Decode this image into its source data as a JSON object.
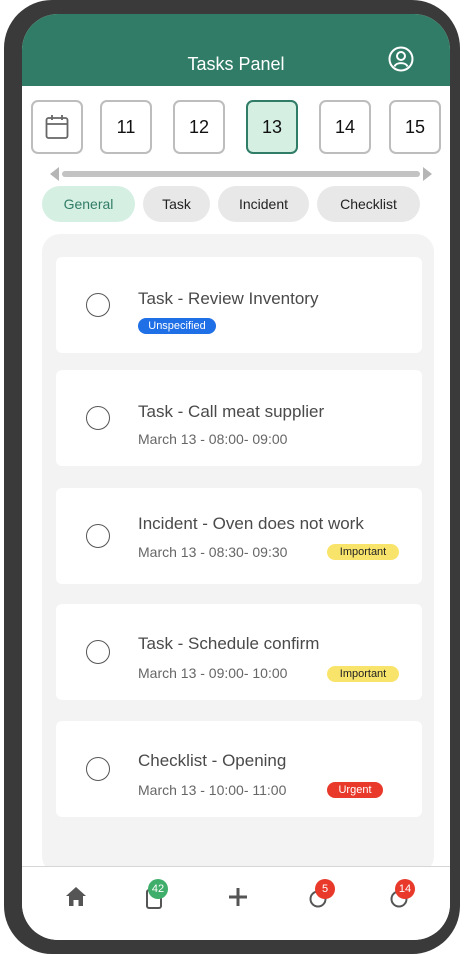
{
  "header": {
    "title": "Tasks Panel",
    "profile_icon": "user-circle-icon"
  },
  "dates": [
    {
      "type": "calendar",
      "icon": "calendar-icon",
      "selected": false
    },
    {
      "label": "11",
      "selected": false
    },
    {
      "label": "12",
      "selected": false
    },
    {
      "label": "13",
      "selected": true
    },
    {
      "label": "14",
      "selected": false
    },
    {
      "label": "15",
      "selected": false
    }
  ],
  "filters": [
    {
      "label": "General",
      "active": true
    },
    {
      "label": "Task",
      "active": false
    },
    {
      "label": "Incident",
      "active": false
    },
    {
      "label": "Checklist",
      "active": false
    }
  ],
  "tasks": [
    {
      "title": "Task - Review Inventory",
      "time": "",
      "badge": "Unspecified",
      "badge_color": "#1f6fe6",
      "badge_text_color": "#ffffff"
    },
    {
      "title": "Task - Call meat supplier",
      "time": "March 13 - 08:00- 09:00",
      "badge": "",
      "badge_color": "",
      "badge_text_color": ""
    },
    {
      "title": "Incident - Oven does not work",
      "time": "March 13 - 08:30- 09:30",
      "badge": "Important",
      "badge_color": "#f9e46b",
      "badge_text_color": "#222222"
    },
    {
      "title": "Task - Schedule confirm",
      "time": "March 13 - 09:00- 10:00",
      "badge": "Important",
      "badge_color": "#f9e46b",
      "badge_text_color": "#222222"
    },
    {
      "title": "Checklist - Opening",
      "time": "March 13 - 10:00- 11:00",
      "badge": "Urgent",
      "badge_color": "#e8392b",
      "badge_text_color": "#ffffff"
    }
  ],
  "nav": {
    "home_icon": "home-icon",
    "tasks_icon": "clipboard-icon",
    "tasks_badge": "42",
    "add_icon": "plus-icon",
    "incidents_icon": "incidents-icon",
    "incidents_badge": "5",
    "checklists_icon": "checklist-icon",
    "checklists_badge": "14"
  },
  "colors": {
    "brand": "#317c66",
    "selected_bg": "#d5efe3",
    "badge_green": "#3fae6a",
    "badge_red": "#e8392b"
  }
}
